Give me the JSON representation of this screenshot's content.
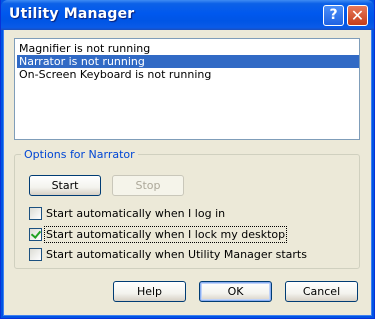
{
  "window": {
    "title": "Utility Manager",
    "help_glyph": "?",
    "close_glyph": "✕"
  },
  "list": {
    "items": [
      {
        "label": "Magnifier is not running",
        "selected": false
      },
      {
        "label": "Narrator is not running",
        "selected": true
      },
      {
        "label": "On-Screen Keyboard is not running",
        "selected": false
      }
    ]
  },
  "options": {
    "group_title": "Options for Narrator",
    "start_label": "Start",
    "stop_label": "Stop",
    "checkboxes": [
      {
        "label": "Start automatically when I log in",
        "checked": false
      },
      {
        "label": "Start automatically when I lock my desktop",
        "checked": true
      },
      {
        "label": "Start automatically when Utility Manager starts",
        "checked": false
      }
    ]
  },
  "footer": {
    "help_label": "Help",
    "ok_label": "OK",
    "cancel_label": "Cancel"
  },
  "colors": {
    "titlebar": "#0055e5",
    "selection": "#316ac5",
    "group_title": "#0046d5",
    "face": "#ece9d8"
  }
}
